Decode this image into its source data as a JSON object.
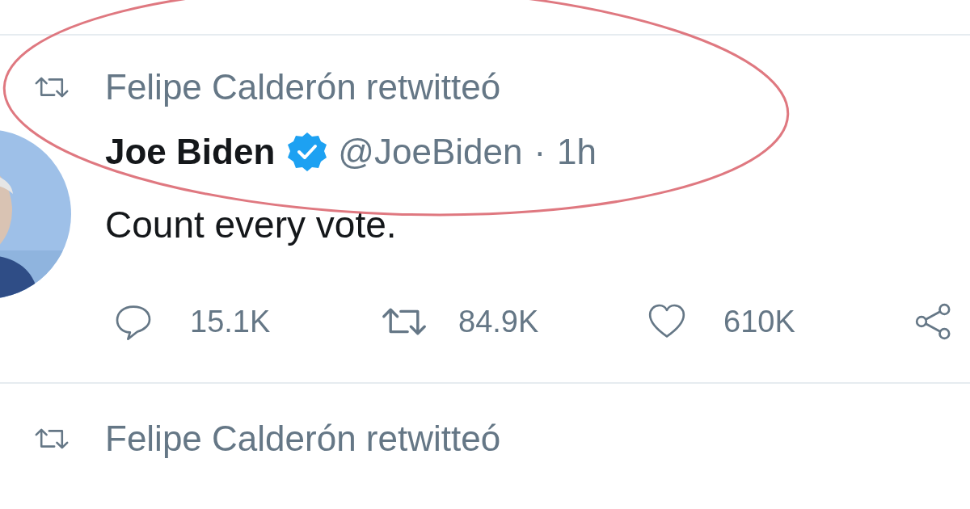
{
  "retweet_header": {
    "text": "Felipe Calderón retwitteó"
  },
  "tweet": {
    "author": "Joe Biden",
    "verified": true,
    "handle": "@JoeBiden",
    "separator": "·",
    "time": "1h",
    "text": "Count every vote.",
    "actions": [
      {
        "kind": "reply",
        "count": "15.1K"
      },
      {
        "kind": "retweet",
        "count": "84.9K"
      },
      {
        "kind": "like",
        "count": "610K"
      },
      {
        "kind": "share"
      }
    ]
  },
  "next_retweet_header": {
    "text": "Felipe Calderón retwitteó"
  }
}
